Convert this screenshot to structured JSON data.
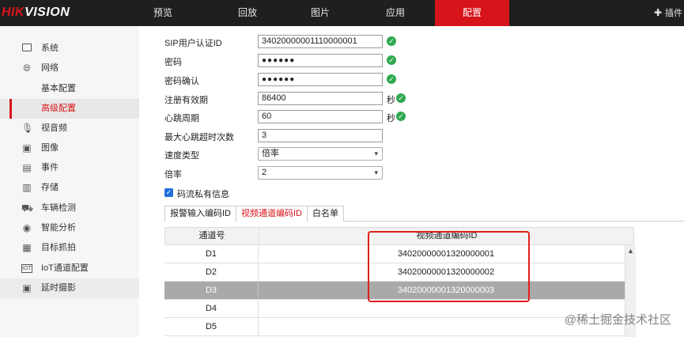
{
  "brand": {
    "logo_red": "HIK",
    "logo_white": "VISION"
  },
  "nav": {
    "tabs": [
      {
        "label": "预览"
      },
      {
        "label": "回放"
      },
      {
        "label": "图片"
      },
      {
        "label": "应用"
      },
      {
        "label": "配置"
      }
    ],
    "active": "配置",
    "plugin_label": "插件"
  },
  "sidebar": {
    "items": [
      {
        "label": "系统",
        "icon": "monitor-icon"
      },
      {
        "label": "网络",
        "icon": "globe-icon"
      },
      {
        "label": "基本配置",
        "icon": ""
      },
      {
        "label": "高级配置",
        "icon": ""
      },
      {
        "label": "视音频",
        "icon": "microphone-icon"
      },
      {
        "label": "图像",
        "icon": "image-icon"
      },
      {
        "label": "事件",
        "icon": "calendar-icon"
      },
      {
        "label": "存储",
        "icon": "storage-icon"
      },
      {
        "label": "车辆检测",
        "icon": "car-icon"
      },
      {
        "label": "智能分析",
        "icon": "smart-icon"
      },
      {
        "label": "目标抓拍",
        "icon": "capture-icon"
      },
      {
        "label": "IoT通道配置",
        "icon": "iot-icon"
      },
      {
        "label": "延时摄影",
        "icon": "timelapse-icon"
      }
    ]
  },
  "form": {
    "sip_user_id": {
      "label": "SIP用户认证ID",
      "value": "34020000001110000001"
    },
    "password": {
      "label": "密码",
      "value": "●●●●●●"
    },
    "password_confirm": {
      "label": "密码确认",
      "value": "●●●●●●"
    },
    "reg_validity": {
      "label": "注册有效期",
      "value": "86400",
      "unit": "秒"
    },
    "heartbeat": {
      "label": "心跳周期",
      "value": "60",
      "unit": "秒"
    },
    "max_timeout": {
      "label": "最大心跳超时次数",
      "value": "3"
    },
    "speed_type": {
      "label": "速度类型",
      "value": "倍率"
    },
    "rate": {
      "label": "倍率",
      "value": "2"
    },
    "private_info": {
      "label": "码流私有信息",
      "checked": true
    }
  },
  "tabs": {
    "items": [
      {
        "label": "报警输入编码ID"
      },
      {
        "label": "视频通道编码ID"
      },
      {
        "label": "白名单"
      }
    ],
    "active": "视频通道编码ID"
  },
  "table": {
    "headers": [
      "通道号",
      "视频通道编码ID"
    ],
    "rows": [
      {
        "channel": "D1",
        "code": "34020000001320000001"
      },
      {
        "channel": "D2",
        "code": "34020000001320000002"
      },
      {
        "channel": "D3",
        "code": "34020000001320000003"
      },
      {
        "channel": "D4",
        "code": ""
      },
      {
        "channel": "D5",
        "code": ""
      }
    ],
    "selected_row": "D3"
  },
  "colors": {
    "accent": "#d7141a",
    "ok": "#2fa84f",
    "highlight": "#e0201a"
  },
  "watermark": "@稀土掘金技术社区"
}
